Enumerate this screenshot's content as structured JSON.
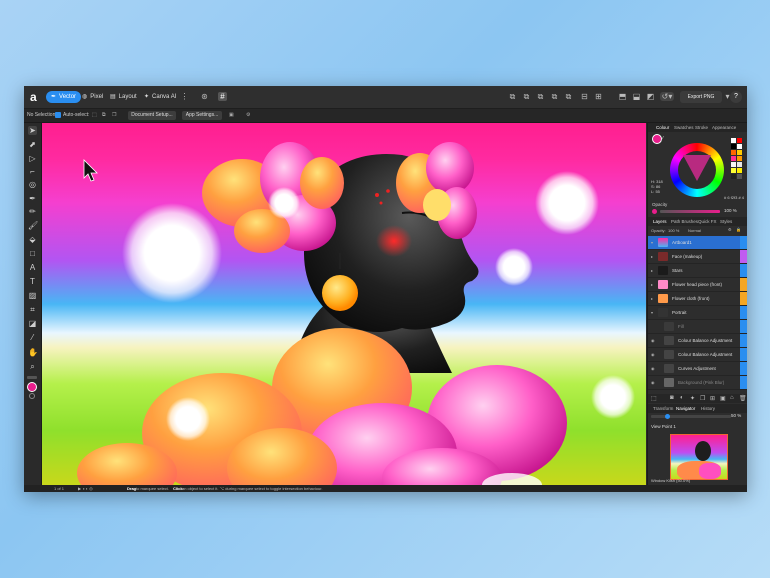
{
  "app": {
    "logo_glyph": "a"
  },
  "toolbar_top": {
    "personas": [
      {
        "label": "Vector",
        "active": true,
        "icon": "pen-nib-icon"
      },
      {
        "label": "Pixel",
        "active": false,
        "icon": "pixel-icon"
      },
      {
        "label": "Layout",
        "active": false,
        "icon": "layout-icon"
      },
      {
        "label": "Canva AI",
        "active": false,
        "icon": "sparkle-icon"
      }
    ],
    "export_label": "Export PNG",
    "help_label": "?"
  },
  "context_bar": {
    "selection_text": "No Selection",
    "auto_select_label": "Auto-select:",
    "document_setup_label": "Document Setup...",
    "app_settings_label": "App Settings..."
  },
  "panels": {
    "top_tabs": [
      "Colour",
      "Swatches",
      "Stroke",
      "Appearance"
    ],
    "colour_readout": {
      "h": "H: 318",
      "s": "S: 86",
      "l": "L: 55",
      "hex": "# 6 f2f3 # 4"
    },
    "opacity_label": "Opacity",
    "opacity_value": "100 %",
    "layer_tabs": [
      "Layers",
      "Path Brushes",
      "Quick FX",
      "Styles"
    ],
    "layers_opacity_label": "Opacity:",
    "layers_opacity_value": "100 %",
    "blend_mode": "Normal",
    "layers": [
      {
        "name": "Artboard1",
        "selected": true,
        "tag": "#2a8ef0"
      },
      {
        "name": "Face (makeup)",
        "selected": false,
        "tag": "#c05cf0"
      },
      {
        "name": "Stars",
        "selected": false,
        "tag": "#2a8ef0"
      },
      {
        "name": "Flower head piece (front)",
        "selected": false,
        "tag": "#f5a623"
      },
      {
        "name": "Flower cloth (front)",
        "selected": false,
        "tag": "#f5a623"
      },
      {
        "name": "Portrait",
        "selected": false,
        "tag": "#2a8ef0"
      },
      {
        "name": "Fill",
        "selected": false,
        "tag": "#2a8ef0"
      },
      {
        "name": "Colour Balance Adjustment",
        "selected": false,
        "tag": "#2a8ef0"
      },
      {
        "name": "Colour Balance Adjustment",
        "selected": false,
        "tag": "#2a8ef0"
      },
      {
        "name": "Curves Adjustment",
        "selected": false,
        "tag": "#2a8ef0"
      },
      {
        "name": "Background (Pink Blur)",
        "selected": false,
        "tag": "#2a8ef0"
      }
    ],
    "nav_tabs": [
      "Transform",
      "Navigator",
      "History"
    ],
    "zoom_value": "50 %",
    "view_point_label": "View Point 1",
    "window_label": "Window Kilsh (50.0%)"
  },
  "status": {
    "page_text": "1 of 1",
    "hint_drag": "Drag",
    "hint_text_1": " to marquee select. ",
    "hint_click": "Click",
    "hint_text_2": " an object to select it. ⌥ during marquee select to toggle intersection behaviour."
  }
}
